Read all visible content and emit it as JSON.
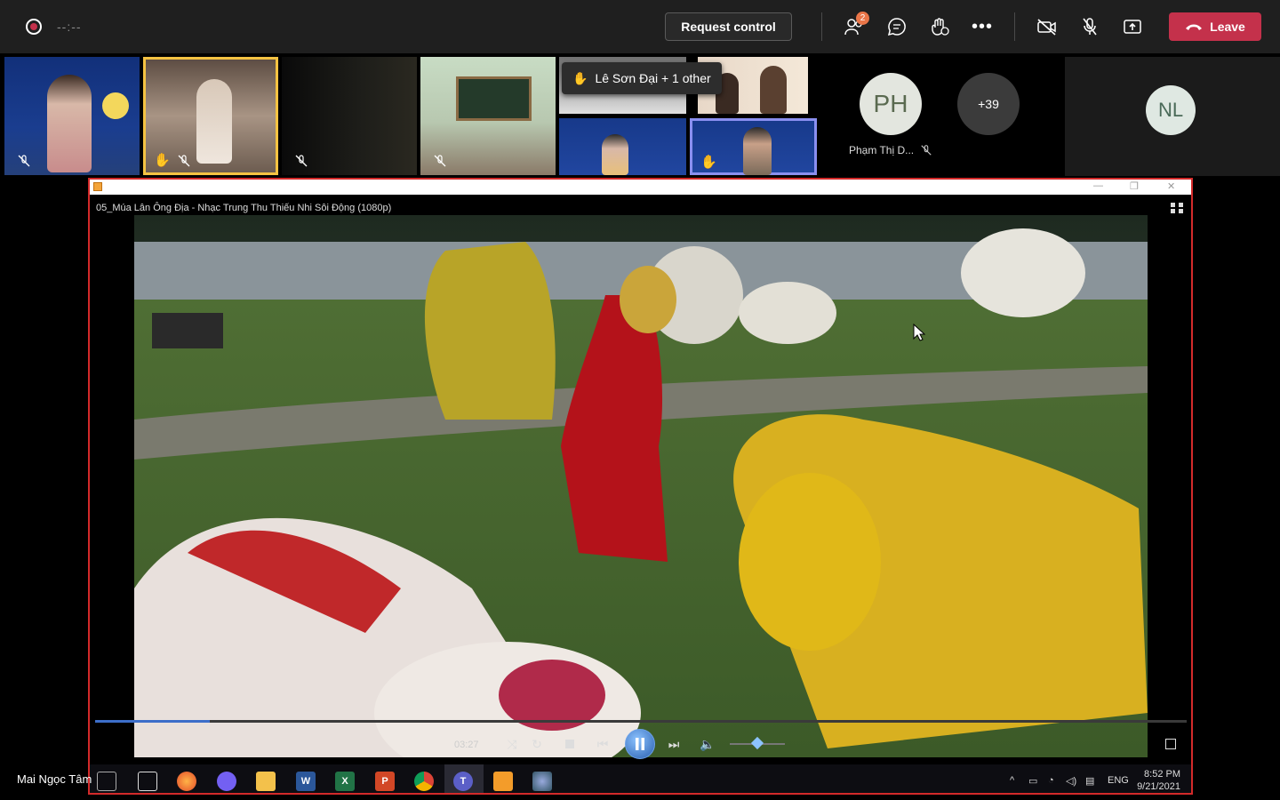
{
  "meeting": {
    "timer": "--:--",
    "request_control": "Request control",
    "leave": "Leave",
    "participants_badge": "2",
    "raised_hands_tooltip": "Lê Sơn Đại + 1 other",
    "overflow_count": "+39",
    "avatar_ph_initials": "PH",
    "avatar_ph_name": "Phạm Thị D...",
    "avatar_nl_initials": "NL",
    "presenter_name": "Mai Ngọc Tâm"
  },
  "colors": {
    "leave": "#c4314b",
    "highlight_yellow": "#f5c342",
    "highlight_blue": "#8a8ff0",
    "share_border": "#d32a2a"
  },
  "player": {
    "video_title": "05_Múa Lân Ông Địa - Nhạc Trung Thu Thiếu Nhi Sôi Động (1080p)",
    "elapsed": "03:27",
    "progress_fraction": 0.105,
    "volume_fraction": 0.5
  },
  "taskbar": {
    "icons": [
      "task-view-icon",
      "firefox-icon",
      "viber-icon",
      "file-explorer-icon",
      "word-icon",
      "excel-icon",
      "powerpoint-icon",
      "chrome-icon",
      "teams-icon",
      "media-player-icon",
      "paint-icon"
    ],
    "lang": "ENG",
    "time": "8:52 PM",
    "date": "9/21/2021"
  }
}
